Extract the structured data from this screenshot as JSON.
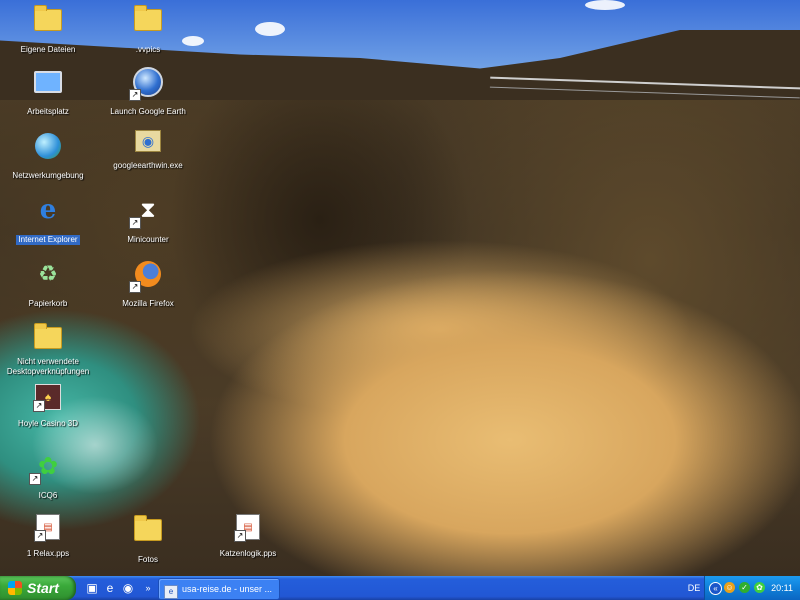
{
  "desktop": {
    "icons": [
      {
        "label": "Eigene Dateien",
        "icon": "my-documents-icon"
      },
      {
        "label": ".vvpics",
        "icon": "folder-icon"
      },
      {
        "label": "Arbeitsplatz",
        "icon": "my-computer-icon"
      },
      {
        "label": "Launch Google Earth",
        "icon": "google-earth-icon"
      },
      {
        "label": "Netzwerkumgebung",
        "icon": "network-icon"
      },
      {
        "label": "googleearthwin.exe",
        "icon": "installer-icon"
      },
      {
        "label": "Internet Explorer",
        "icon": "internet-explorer-icon"
      },
      {
        "label": "Minicounter",
        "icon": "hourglass-icon"
      },
      {
        "label": "Papierkorb",
        "icon": "recycle-bin-icon"
      },
      {
        "label": "Mozilla Firefox",
        "icon": "firefox-icon"
      },
      {
        "label": "Nicht verwendete\nDesktopverknüpfungen",
        "icon": "folder-icon"
      },
      {
        "label": "Hoyle Casino 3D",
        "icon": "casino-icon"
      },
      {
        "label": "ICQ6",
        "icon": "icq-flower-icon"
      },
      {
        "label": "1 Relax.pps",
        "icon": "pps-file-icon"
      },
      {
        "label": "Fotos",
        "icon": "folder-icon"
      },
      {
        "label": "Katzenlogik.pps",
        "icon": "pps-file-icon"
      }
    ]
  },
  "taskbar": {
    "start_label": "Start",
    "task_button_label": "usa-reise.de - unser ...",
    "language": "DE",
    "clock": "20:11",
    "colors": {
      "taskbar": "#245edb",
      "start": "#3aa93a",
      "tray": "#0f7fd9"
    }
  }
}
